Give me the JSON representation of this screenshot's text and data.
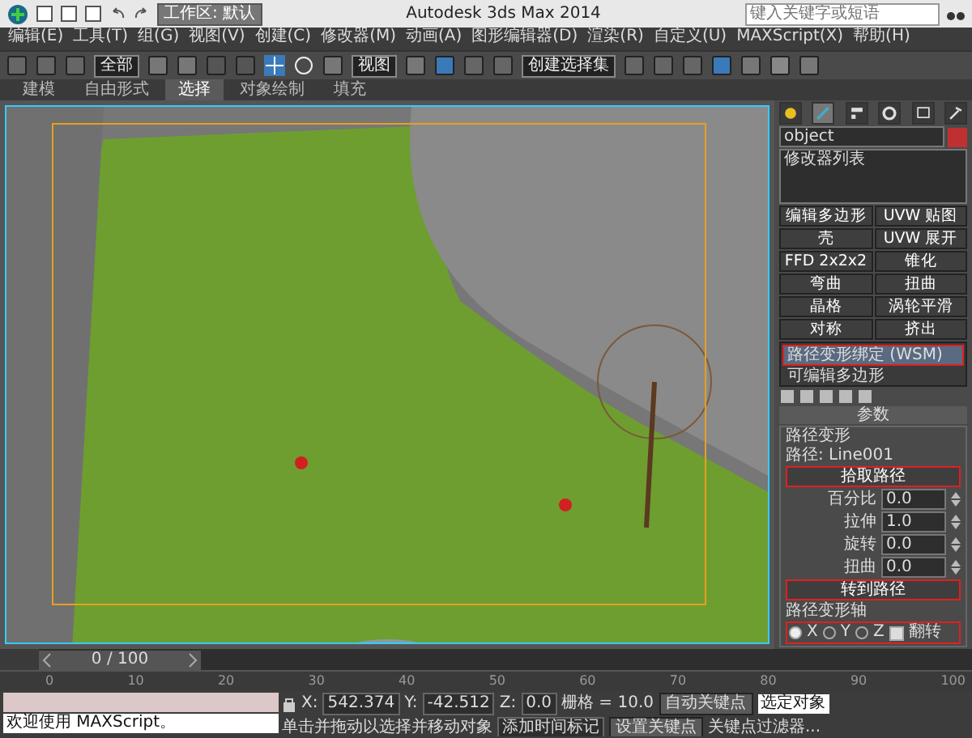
{
  "title_bar": {
    "workspace": "工作区: 默认",
    "title": "Autodesk 3ds Max 2014",
    "search": {
      "placeholder": "键入关键字或短语"
    }
  },
  "menu": [
    "编辑(E)",
    "工具(T)",
    "组(G)",
    "视图(V)",
    "创建(C)",
    "修改器(M)",
    "动画(A)",
    "图形编辑器(D)",
    "渲染(R)",
    "自定义(U)",
    "MAXScript(X)",
    "帮助(H)"
  ],
  "toolbar": {
    "selection_filter": "全部",
    "reference_coord": "视图",
    "named_selection": "创建选择集"
  },
  "ribbon_tabs": [
    {
      "label": "建模",
      "selected": false
    },
    {
      "label": "自由形式",
      "selected": false
    },
    {
      "label": "选择",
      "selected": true
    },
    {
      "label": "对象绘制",
      "selected": false
    },
    {
      "label": "填充",
      "selected": false
    }
  ],
  "command_panel": {
    "tabs": [
      {
        "kind": "create",
        "selected": false
      },
      {
        "kind": "modify",
        "selected": true
      },
      {
        "kind": "hierarchy",
        "selected": false
      },
      {
        "kind": "motion",
        "selected": false
      },
      {
        "kind": "display",
        "selected": false
      },
      {
        "kind": "utilities",
        "selected": false
      }
    ],
    "object_name": "object",
    "modifier_list": "修改器列表",
    "modifier_buttons": [
      "编辑多边形",
      "UVW 贴图",
      "壳",
      "UVW 展开",
      "FFD 2x2x2",
      "锥化",
      "弯曲",
      "扭曲",
      "晶格",
      "涡轮平滑",
      "对称",
      "挤出"
    ],
    "stack": [
      {
        "label": "路径变形绑定 (WSM)",
        "selected": true,
        "highlighted": true
      },
      {
        "label": "可编辑多边形",
        "selected": false,
        "highlighted": false
      }
    ],
    "rollout": "参数",
    "group": "路径变形",
    "path_label": "路径: Line001",
    "pick_button": {
      "label": "拾取路径",
      "highlighted": true
    },
    "spinners": [
      {
        "label": "百分比",
        "value": "0.0"
      },
      {
        "label": "拉伸",
        "value": "1.0"
      },
      {
        "label": "旋转",
        "value": "0.0"
      },
      {
        "label": "扭曲",
        "value": "0.0"
      }
    ],
    "goto_button": {
      "label": "转到路径",
      "highlighted": true
    },
    "axis_group": "路径变形轴",
    "axis_highlighted": true,
    "axes": [
      {
        "label": "X",
        "selected": true
      },
      {
        "label": "Y",
        "selected": false
      },
      {
        "label": "Z",
        "selected": false
      }
    ],
    "flip": {
      "label": "翻转",
      "checked": true
    }
  },
  "timeline": {
    "frame": "0 / 100",
    "level": 0,
    "ticks": [
      "0",
      "10",
      "20",
      "30",
      "40",
      "50",
      "60",
      "70",
      "80",
      "90",
      "100"
    ]
  },
  "status_bar": {
    "listener": "欢迎使用 MAXScript。",
    "coordinates": [
      {
        "label": "X:",
        "value": "542.374"
      },
      {
        "label": "Y:",
        "value": "-42.512"
      },
      {
        "label": "Z:",
        "value": "0.0"
      }
    ],
    "grid": "栅格 = 10.0",
    "prompt": "单击并拖动以选择并移动对象",
    "auto_key": "自动关键点",
    "set_key": "设置关键点",
    "key_mode": "选定对象",
    "key_filters": "关键点过滤器...",
    "add_tag": "添加时间标记"
  }
}
